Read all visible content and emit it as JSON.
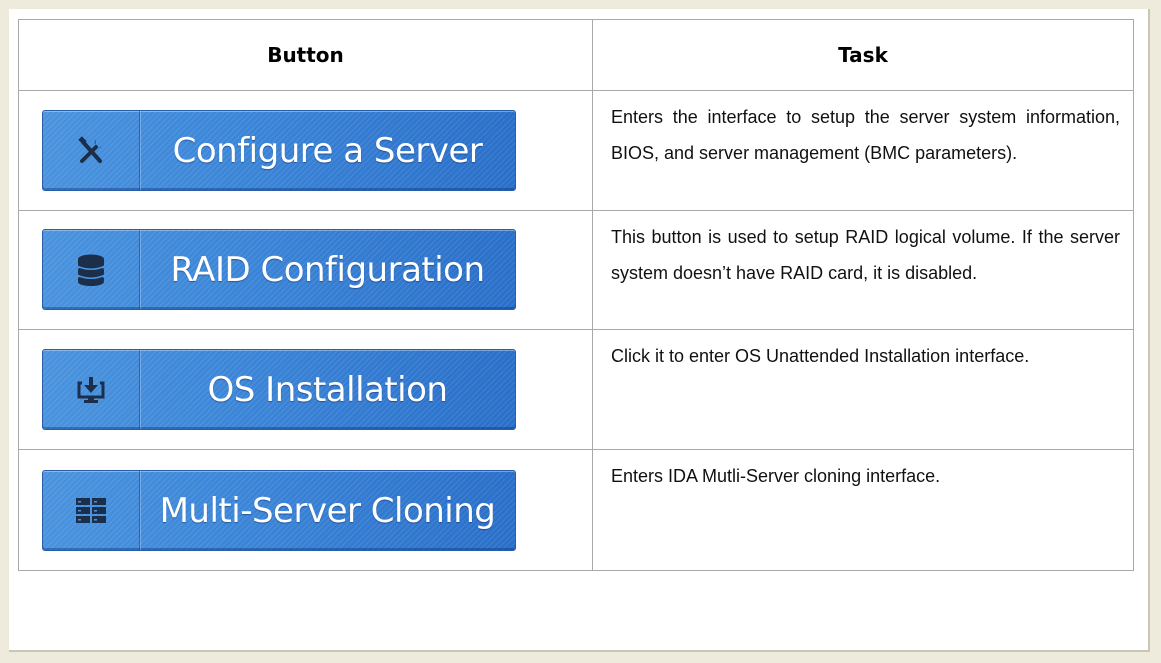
{
  "table": {
    "headers": {
      "button": "Button",
      "task": "Task"
    },
    "rows": [
      {
        "button_label": "Configure a Server",
        "icon": "tools-icon",
        "task": "Enters the interface to setup the server system information, BIOS, and server management (BMC parameters)."
      },
      {
        "button_label": "RAID Configuration",
        "icon": "database-icon",
        "task": "This button is used to setup RAID logical volume. If the server system doesn’t have RAID card, it is disabled."
      },
      {
        "button_label": "OS Installation",
        "icon": "install-monitor-icon",
        "task": "Click it to enter OS Unattended Installation interface."
      },
      {
        "button_label": "Multi-Server Cloning",
        "icon": "server-rack-icon",
        "task": "Enters IDA Mutli-Server cloning interface."
      }
    ]
  },
  "colors": {
    "button_blue": "#3c86d8",
    "icon_dark": "#1c2f4a",
    "page_border": "#eeebdd"
  }
}
